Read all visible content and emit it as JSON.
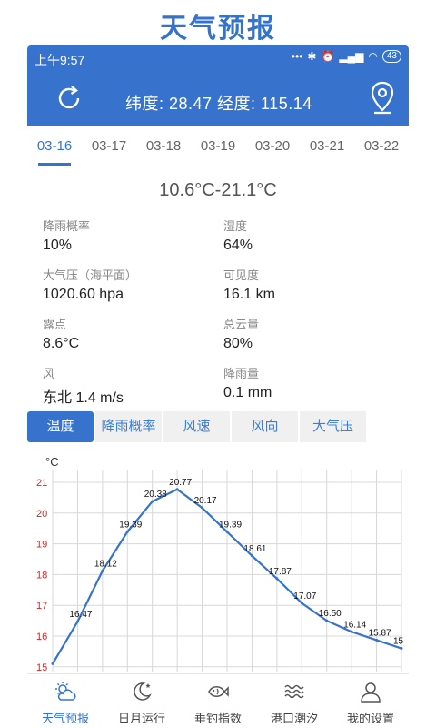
{
  "page_title": "天气预报",
  "status_bar": {
    "time": "上午9:57",
    "battery": "43"
  },
  "header": {
    "coords": "纬度: 28.47 经度: 115.14"
  },
  "date_tabs": [
    "03-16",
    "03-17",
    "03-18",
    "03-19",
    "03-20",
    "03-21",
    "03-22"
  ],
  "temp_range": "10.6°C-21.1°C",
  "details": [
    {
      "label": "降雨概率",
      "value": "10%"
    },
    {
      "label": "湿度",
      "value": "64%"
    },
    {
      "label": "大气压（海平面）",
      "value": "1020.60 hpa"
    },
    {
      "label": "可见度",
      "value": "16.1 km"
    },
    {
      "label": "露点",
      "value": "8.6°C"
    },
    {
      "label": "总云量",
      "value": "80%"
    },
    {
      "label": "风",
      "value": "东北 1.4 m/s"
    },
    {
      "label": "降雨量",
      "value": "0.1 mm"
    }
  ],
  "metric_tabs": [
    "温度",
    "降雨概率",
    "风速",
    "风向",
    "大气压"
  ],
  "chart_data": {
    "type": "line",
    "ylabel": "°C",
    "yticks": [
      "21",
      "20",
      "19",
      "18",
      "17",
      "16",
      "15"
    ],
    "ylim": [
      15,
      21
    ],
    "grid": true,
    "values": [
      15.1,
      16.47,
      18.12,
      19.39,
      20.38,
      20.77,
      20.17,
      19.39,
      18.61,
      17.87,
      17.07,
      16.5,
      16.14,
      15.87,
      15.6
    ],
    "data_labels": [
      "",
      "16.47",
      "18.12",
      "19.39",
      "20.38",
      "20.77",
      "20.17",
      "19.39",
      "18.61",
      "17.87",
      "17.07",
      "16.50",
      "16.14",
      "15.87",
      "15"
    ],
    "series_color": "#3773cc"
  },
  "bottom_nav": [
    "天气预报",
    "日月运行",
    "垂钓指数",
    "港口潮汐",
    "我的设置"
  ],
  "colors": {
    "accent": "#3773cc",
    "tick_red": "#e02020"
  }
}
